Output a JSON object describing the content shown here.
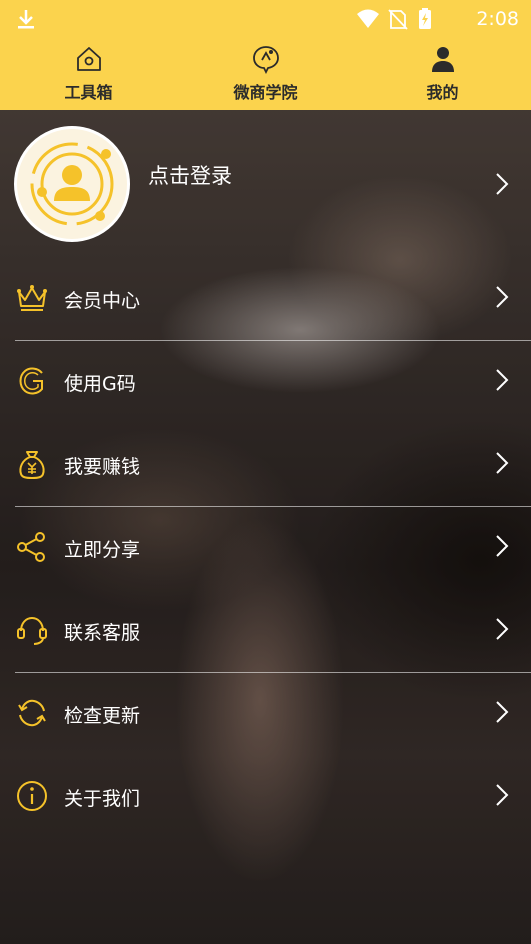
{
  "status_bar": {
    "time": "2:08"
  },
  "tabs": [
    {
      "label": "工具箱",
      "icon": "home-icon"
    },
    {
      "label": "微商学院",
      "icon": "academy-icon"
    },
    {
      "label": "我的",
      "icon": "person-icon"
    }
  ],
  "profile": {
    "login_label": "点击登录",
    "avatar_icon": "user-avatar-icon"
  },
  "menu": [
    {
      "label": "会员中心",
      "icon": "crown-icon"
    },
    {
      "label": "使用G码",
      "icon": "g-code-icon"
    },
    {
      "label": "我要赚钱",
      "icon": "money-bag-icon"
    },
    {
      "label": "立即分享",
      "icon": "share-icon"
    },
    {
      "label": "联系客服",
      "icon": "headset-icon"
    },
    {
      "label": "检查更新",
      "icon": "refresh-icon"
    },
    {
      "label": "关于我们",
      "icon": "info-icon"
    }
  ],
  "colors": {
    "header": "#fbd34d",
    "accent": "#f5c22a",
    "text_on_dark": "#ffffff"
  }
}
